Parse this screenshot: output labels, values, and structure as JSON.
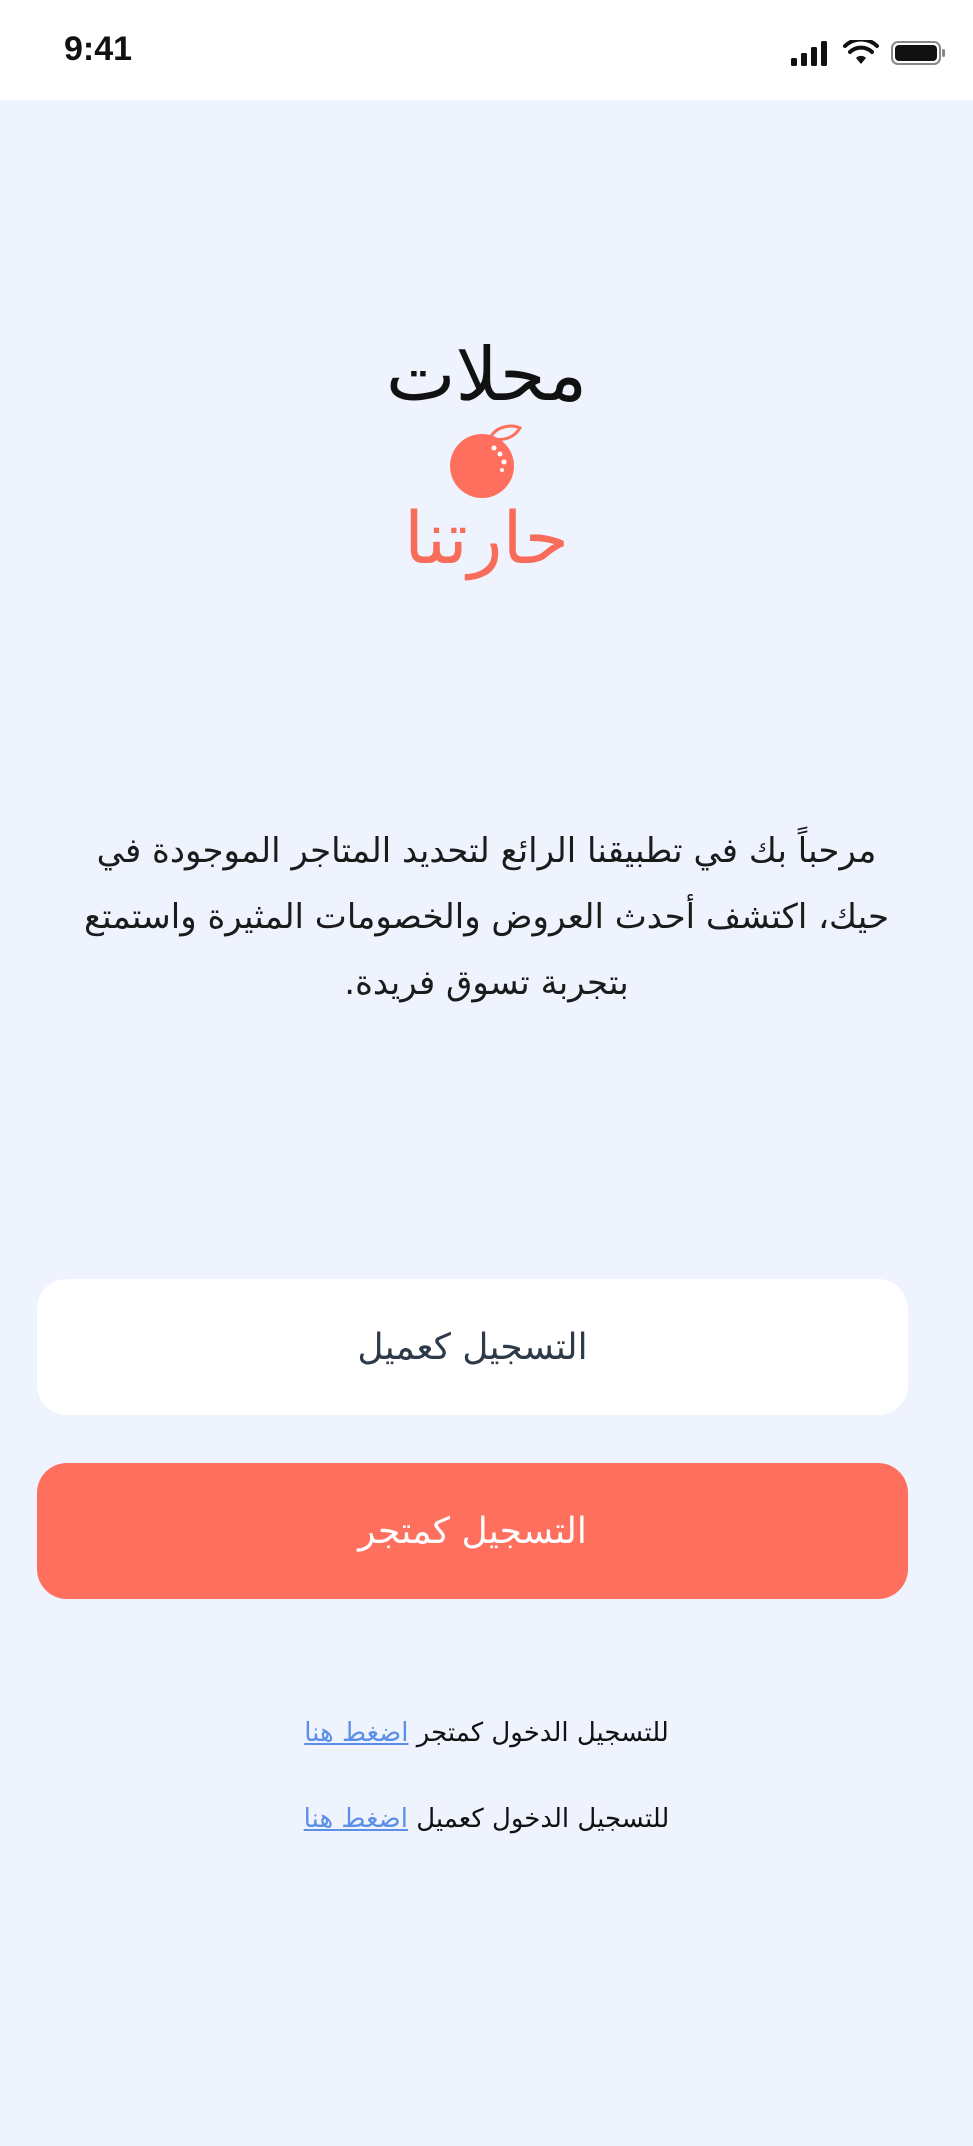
{
  "status_bar": {
    "time": "9:41",
    "icons": [
      "cellular-signal-icon",
      "wifi-icon",
      "battery-icon"
    ]
  },
  "logo": {
    "top_text": "محلات",
    "fruit_icon": "orange-icon",
    "bottom_text": "حارتنا"
  },
  "welcome": {
    "text": "مرحباً بك في تطبيقنا الرائع لتحديد المتاجر الموجودة في حيك، اكتشف أحدث العروض والخصومات المثيرة واستمتع بتجربة تسوق فريدة."
  },
  "buttons": {
    "register_customer": "التسجيل كعميل",
    "register_merchant": "التسجيل كمتجر"
  },
  "login_links": {
    "merchant_text": "للتسجيل الدخول كمتجر",
    "merchant_link": "اضغط هنا",
    "customer_text": "للتسجيل الدخول كعميل",
    "customer_link": "اضغط هنا"
  },
  "colors": {
    "background": "#eef3fd",
    "accent": "#fe6f5e",
    "link": "#5b8fe8"
  }
}
